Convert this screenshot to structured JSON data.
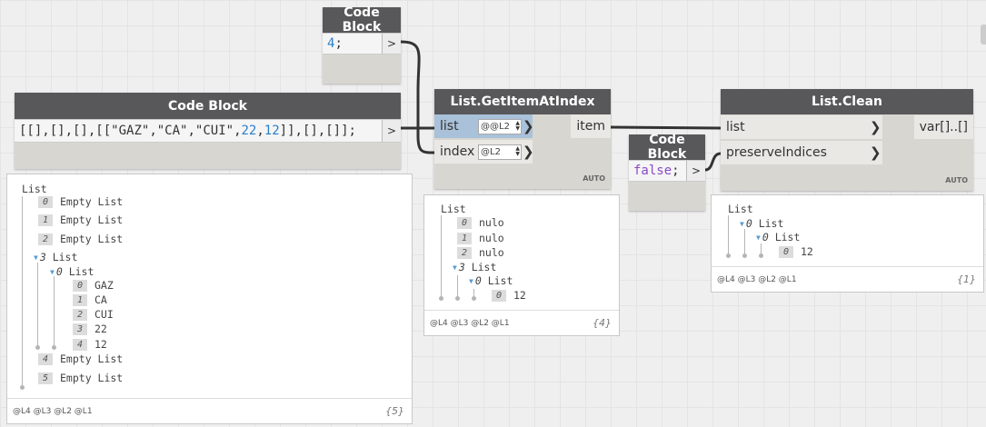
{
  "nodes": {
    "code_block_top": {
      "title": "Code Block",
      "code_num": "4",
      "code_end": ";",
      "out": ">"
    },
    "code_block_left": {
      "title": "Code Block",
      "code": [
        {
          "t": "[[],[],[],[[",
          "c": "p"
        },
        {
          "t": "\"GAZ\"",
          "c": "s"
        },
        {
          "t": ",",
          "c": "p"
        },
        {
          "t": "\"CA\"",
          "c": "s"
        },
        {
          "t": ",",
          "c": "p"
        },
        {
          "t": "\"CUI\"",
          "c": "s"
        },
        {
          "t": ",",
          "c": "p"
        },
        {
          "t": "22",
          "c": "n"
        },
        {
          "t": ",",
          "c": "p"
        },
        {
          "t": "12",
          "c": "n"
        },
        {
          "t": "]],[],[]];",
          "c": "p"
        }
      ],
      "out": ">"
    },
    "get_item": {
      "title": "List.GetItemAtIndex",
      "in1": "list",
      "lace1": "@@L2",
      "in2": "index",
      "lace2": "@L2",
      "out": "item",
      "mode": "AUTO"
    },
    "code_block_false": {
      "title": "Code Block",
      "code": "false",
      "code_end": ";",
      "out": ">"
    },
    "list_clean": {
      "title": "List.Clean",
      "in1": "list",
      "in2": "preserveIndices",
      "out": "var[]..[]",
      "mode": "AUTO"
    }
  },
  "previews": {
    "left": {
      "root": "List",
      "items": [
        {
          "idx": "0",
          "text": "Empty List"
        },
        {
          "idx": "1",
          "text": "Empty List"
        },
        {
          "idx": "2",
          "text": "Empty List"
        },
        {
          "idx": "3",
          "text": "List",
          "expanded": true
        },
        {
          "idx": "0",
          "text": "List",
          "expanded": true
        },
        {
          "idx": "0",
          "text": "GAZ"
        },
        {
          "idx": "1",
          "text": "CA"
        },
        {
          "idx": "2",
          "text": "CUI"
        },
        {
          "idx": "3",
          "text": "22"
        },
        {
          "idx": "4",
          "text": "12"
        },
        {
          "idx": "4",
          "text": "Empty List"
        },
        {
          "idx": "5",
          "text": "Empty List"
        }
      ],
      "levels": "@L4 @L3 @L2 @L1",
      "count": "{5}"
    },
    "middle": {
      "root": "List",
      "items": [
        {
          "idx": "0",
          "text": "nulo"
        },
        {
          "idx": "1",
          "text": "nulo"
        },
        {
          "idx": "2",
          "text": "nulo"
        },
        {
          "idx": "3",
          "text": "List",
          "expanded": true
        },
        {
          "idx": "0",
          "text": "List",
          "expanded": true
        },
        {
          "idx": "0",
          "text": "12"
        }
      ],
      "levels": "@L4 @L3 @L2 @L1",
      "count": "{4}"
    },
    "right": {
      "root": "List",
      "items": [
        {
          "idx": "0",
          "text": "List",
          "expanded": true
        },
        {
          "idx": "0",
          "text": "List",
          "expanded": true
        },
        {
          "idx": "0",
          "text": "12"
        }
      ],
      "levels": "@L4 @L3 @L2 @L1",
      "count": "{1}"
    }
  },
  "colors": {
    "title_bar": "#58585a",
    "node_body": "#d8d6d1",
    "active_port": "#a9c1d9",
    "number": "#2a7fc9",
    "keyword": "#8a4ac8",
    "wire": "#333333"
  }
}
